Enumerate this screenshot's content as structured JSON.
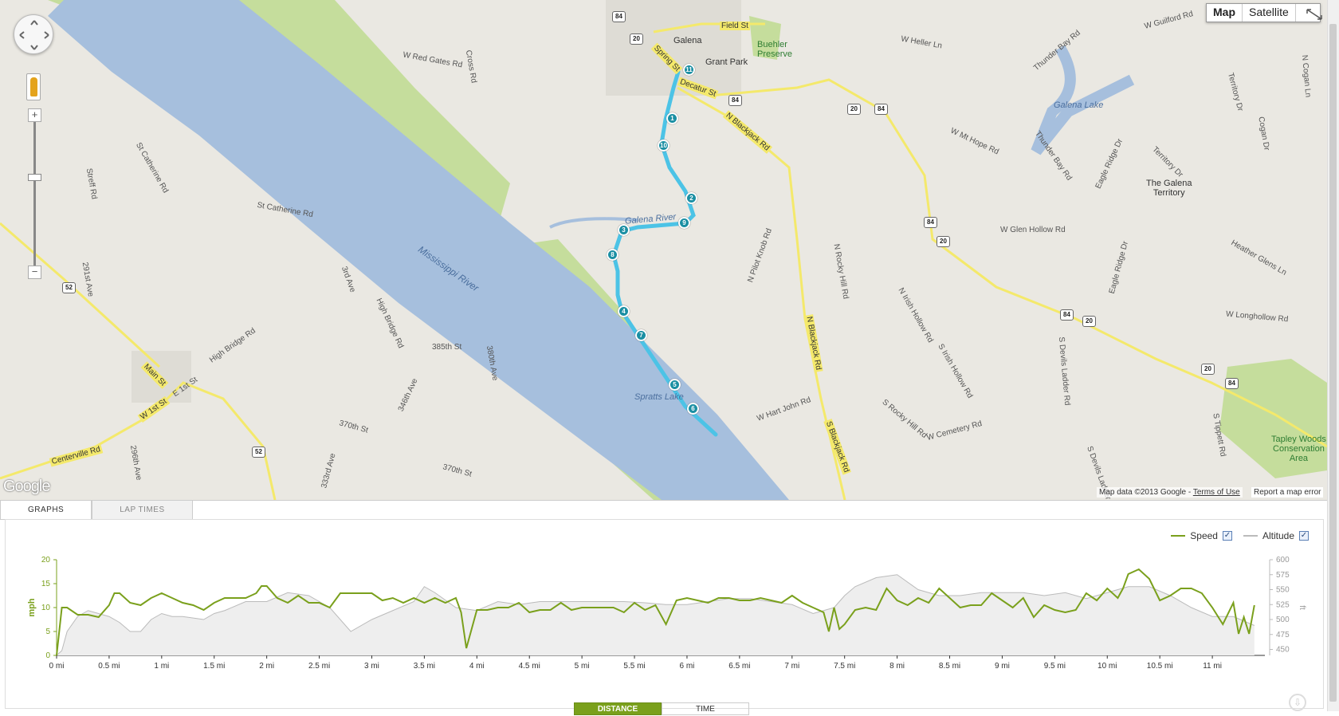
{
  "map": {
    "labels": {
      "galena": "Galena",
      "field_st": "Field St",
      "buehler": "Buehler\nPreserve",
      "grant_park": "Grant Park",
      "spring_st": "Spring St",
      "decatur_st": "Decatur St",
      "n_blackjack": "N Blackjack Rd",
      "galena_river": "Galena River",
      "mississippi": "Mississippi River",
      "spratts_lake": "Spratts Lake",
      "w_red_gates": "W Red Gates Rd",
      "cross_rd": "Cross Rd",
      "st_catherine_rd": "St Catherine Rd",
      "st_catherine_rd2": "St Catherine Rd",
      "streff_rd": "Streff Rd",
      "291st_ave": "291st Ave",
      "3rd_ave": "3rd Ave",
      "high_bridge": "High Bridge Rd",
      "high_bridge2": "High Bridge Rd",
      "385th_st": "385th St",
      "380th_ave": "380th Ave",
      "346th_ave": "346th Ave",
      "370th_st": "370th St",
      "370th_st2": "370th St",
      "333rd_ave": "333rd Ave",
      "296th_ave": "296th Ave",
      "main_st": "Main St",
      "w_1st_st": "W 1st St",
      "e_1st_st": "E 1st St",
      "centerville": "Centerville Rd",
      "n_pilot_knob": "N Pilot Knob Rd",
      "n_rocky_hill": "N Rocky Hill Rd",
      "n_blackjack2": "N Blackjack Rd",
      "n_irish_hollow": "N Irish Hollow Rd",
      "s_irish_hollow": "S Irish Hollow Rd",
      "w_hart_john": "W Hart John Rd",
      "s_rocky_hill": "S Rocky Hill Rd",
      "w_cemetery": "W Cemetery Rd",
      "s_blackjack": "S Blackjack Rd",
      "s_devils_ladder": "S Devils Ladder Rd",
      "s_devils_ladder2": "S Devils Ladder Rd",
      "s_tippett": "S Tippett Rd",
      "w_heller": "W Heller Ln",
      "w_guilford": "W Guilford Rd",
      "thunder_bay": "Thunder Bay Rd",
      "n_cogan": "N Cogan Ln",
      "galena_lake": "Galena Lake",
      "territory_dr": "Territory Dr",
      "territory_dr2": "Territory Dr",
      "cogan_dr": "Cogan Dr",
      "w_mt_hope": "W Mt Hope Rd",
      "thunder_bay2": "Thunder Bay Rd",
      "eagle_ridge": "Eagle Ridge Dr",
      "eagle_ridge2": "Eagle Ridge Dr",
      "the_galena_territory": "The Galena\nTerritory",
      "w_glen_hollow": "W Glen Hollow Rd",
      "heatherglens": "Heather Glens Ln",
      "w_longhollow": "W Longhollow Rd",
      "tapley": "Tapley Woods\nConservation\nArea"
    },
    "shields": [
      "84",
      "20",
      "84",
      "20",
      "84",
      "84",
      "20",
      "84",
      "20",
      "52",
      "52",
      "20",
      "84"
    ],
    "lap_markers": [
      "1",
      "2",
      "3",
      "4",
      "5",
      "6",
      "7",
      "8",
      "9",
      "10",
      "11"
    ],
    "google_logo": "Google",
    "attribution": "Map data ©2013 Google - ",
    "terms": "Terms of Use",
    "report_error": "Report a map error",
    "map_type_buttons": {
      "map": "Map",
      "satellite": "Satellite"
    },
    "zoom_in": "+",
    "zoom_out": "−"
  },
  "tabs": {
    "graphs": "GRAPHS",
    "lap_times": "LAP TIMES"
  },
  "legend": {
    "speed": "Speed",
    "altitude": "Altitude",
    "speed_checked": "✓",
    "altitude_checked": "✓"
  },
  "x_toggle": {
    "distance": "DISTANCE",
    "time": "TIME"
  },
  "colors": {
    "speed": "#7aa01c",
    "altitude_line": "#bbbbbb",
    "altitude_fill": "#eeeeee",
    "route": "#4cc3e6",
    "marker": "#1b8fa3",
    "water": "#a6bfdd",
    "park": "#c5dd9c"
  },
  "chart_data": {
    "type": "line",
    "xlabel": "",
    "ylabel": "mph",
    "y2label": "ft",
    "xlim": [
      0,
      11.5
    ],
    "ylim": [
      0,
      20
    ],
    "y2lim": [
      440,
      600
    ],
    "x_ticks": [
      "0 mi",
      "0.5 mi",
      "1 mi",
      "1.5 mi",
      "2 mi",
      "2.5 mi",
      "3 mi",
      "3.5 mi",
      "4 mi",
      "4.5 mi",
      "5 mi",
      "5.5 mi",
      "6 mi",
      "6.5 mi",
      "7 mi",
      "7.5 mi",
      "8 mi",
      "8.5 mi",
      "9 mi",
      "9.5 mi",
      "10 mi",
      "10.5 mi",
      "11 mi"
    ],
    "y_ticks": [
      "0",
      "5",
      "10",
      "15",
      "20"
    ],
    "y2_ticks": [
      "450",
      "475",
      "500",
      "525",
      "550",
      "575",
      "600"
    ],
    "series": [
      {
        "name": "Speed",
        "axis": "left",
        "x": [
          0,
          0.05,
          0.1,
          0.2,
          0.3,
          0.4,
          0.5,
          0.55,
          0.6,
          0.7,
          0.8,
          0.9,
          1.0,
          1.1,
          1.2,
          1.3,
          1.4,
          1.5,
          1.6,
          1.7,
          1.8,
          1.9,
          1.95,
          2.0,
          2.1,
          2.2,
          2.3,
          2.4,
          2.5,
          2.6,
          2.7,
          2.8,
          2.9,
          3.0,
          3.1,
          3.2,
          3.3,
          3.4,
          3.5,
          3.6,
          3.7,
          3.8,
          3.85,
          3.9,
          4.0,
          4.1,
          4.2,
          4.3,
          4.4,
          4.5,
          4.6,
          4.7,
          4.8,
          4.9,
          5.0,
          5.1,
          5.2,
          5.3,
          5.4,
          5.5,
          5.6,
          5.7,
          5.8,
          5.9,
          6.0,
          6.1,
          6.2,
          6.3,
          6.4,
          6.5,
          6.6,
          6.7,
          6.8,
          6.9,
          7.0,
          7.1,
          7.2,
          7.3,
          7.35,
          7.4,
          7.45,
          7.5,
          7.6,
          7.7,
          7.8,
          7.9,
          8.0,
          8.1,
          8.2,
          8.3,
          8.4,
          8.5,
          8.6,
          8.7,
          8.8,
          8.9,
          9.0,
          9.1,
          9.2,
          9.3,
          9.4,
          9.5,
          9.6,
          9.7,
          9.8,
          9.9,
          10.0,
          10.1,
          10.15,
          10.2,
          10.3,
          10.4,
          10.5,
          10.6,
          10.7,
          10.8,
          10.9,
          11.0,
          11.1,
          11.2,
          11.25,
          11.3,
          11.35,
          11.4
        ],
        "values": [
          0,
          10,
          10,
          8.5,
          8.5,
          8,
          10.5,
          13,
          13,
          11,
          10.5,
          12,
          13,
          12,
          11,
          10.5,
          9.5,
          11,
          12,
          12,
          12,
          13,
          14.5,
          14.5,
          12,
          11,
          12.5,
          11,
          11,
          10,
          13,
          13,
          13,
          13,
          11.5,
          12,
          11,
          12,
          11,
          12,
          11,
          12,
          9,
          1.5,
          9.5,
          9.5,
          10,
          10,
          11,
          9,
          9.5,
          9.5,
          11,
          9.5,
          10,
          10,
          10,
          10,
          9,
          11,
          9.5,
          10.5,
          6.5,
          11.5,
          12,
          11.5,
          11,
          12,
          12,
          11.5,
          11.5,
          12,
          11.5,
          11,
          12.5,
          11,
          10,
          9,
          5,
          10,
          5.5,
          6.5,
          9.5,
          10,
          9.5,
          14,
          11.5,
          10.5,
          12,
          11,
          14,
          12,
          10,
          10.5,
          10.5,
          13,
          11.5,
          10,
          12,
          8,
          10.5,
          9.5,
          9,
          9.5,
          13,
          11.5,
          14,
          12,
          14,
          17,
          18,
          16,
          11.5,
          12.5,
          14,
          14,
          13,
          10,
          6.5,
          11,
          4.5,
          8,
          4.5,
          10.5
        ]
      },
      {
        "name": "Altitude",
        "axis": "right",
        "x": [
          0,
          0.05,
          0.1,
          0.2,
          0.3,
          0.4,
          0.5,
          0.6,
          0.7,
          0.8,
          0.9,
          1.0,
          1.1,
          1.2,
          1.4,
          1.5,
          1.6,
          1.8,
          2.0,
          2.2,
          2.4,
          2.6,
          2.8,
          3.0,
          3.2,
          3.4,
          3.5,
          3.6,
          3.8,
          4.0,
          4.2,
          4.4,
          4.6,
          4.8,
          5.0,
          5.2,
          5.4,
          5.6,
          5.8,
          6.0,
          6.2,
          6.4,
          6.6,
          6.8,
          7.0,
          7.2,
          7.4,
          7.5,
          7.6,
          7.8,
          8.0,
          8.2,
          8.4,
          8.6,
          8.8,
          9.0,
          9.2,
          9.4,
          9.6,
          9.8,
          10.0,
          10.2,
          10.4,
          10.6,
          10.8,
          11.0,
          11.2,
          11.4
        ],
        "values": [
          440,
          448,
          480,
          505,
          515,
          510,
          505,
          495,
          480,
          480,
          500,
          510,
          505,
          505,
          500,
          510,
          515,
          530,
          530,
          545,
          540,
          520,
          480,
          500,
          515,
          530,
          555,
          545,
          520,
          515,
          530,
          525,
          530,
          530,
          530,
          530,
          530,
          528,
          525,
          525,
          530,
          535,
          535,
          530,
          525,
          510,
          520,
          540,
          555,
          570,
          575,
          550,
          540,
          540,
          545,
          545,
          545,
          540,
          545,
          535,
          545,
          555,
          555,
          540,
          520,
          505,
          505,
          490
        ]
      }
    ]
  }
}
